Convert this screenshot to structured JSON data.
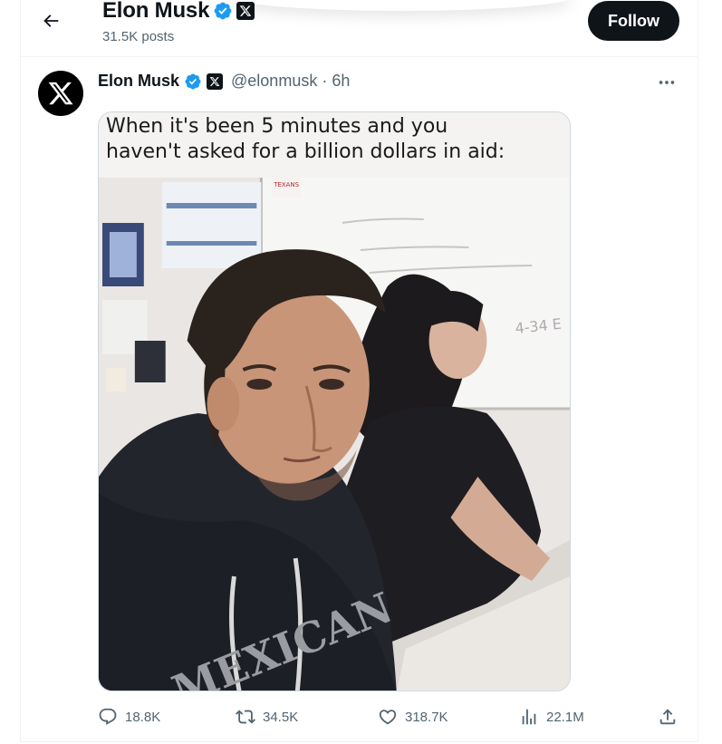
{
  "header": {
    "name": "Elon Musk",
    "posts": "31.5K posts",
    "follow_label": "Follow"
  },
  "tweet": {
    "name": "Elon Musk",
    "handle": "@elonmusk",
    "separator": "·",
    "time": "6h",
    "meme_caption_line1": "When it's been 5 minutes and you",
    "meme_caption_line2": "haven't asked for a billion dollars in aid:",
    "photo_text": {
      "banner": "TEXANS",
      "hoodie": "MEXICAN",
      "whiteboard": "4-34 E"
    }
  },
  "actions": {
    "replies": "18.8K",
    "reposts": "34.5K",
    "likes": "318.7K",
    "views": "22.1M"
  },
  "icons": {
    "back": "arrow-left-icon",
    "verified": "verified-badge-icon",
    "affiliate": "x-logo-icon",
    "more": "more-dots-icon",
    "reply": "reply-icon",
    "repost": "repost-icon",
    "like": "heart-icon",
    "views": "views-chart-icon",
    "share": "share-icon"
  },
  "colors": {
    "accent": "#1d9bf0",
    "text": "#0f1419",
    "muted": "#536471",
    "follow_bg": "#0f1419"
  }
}
